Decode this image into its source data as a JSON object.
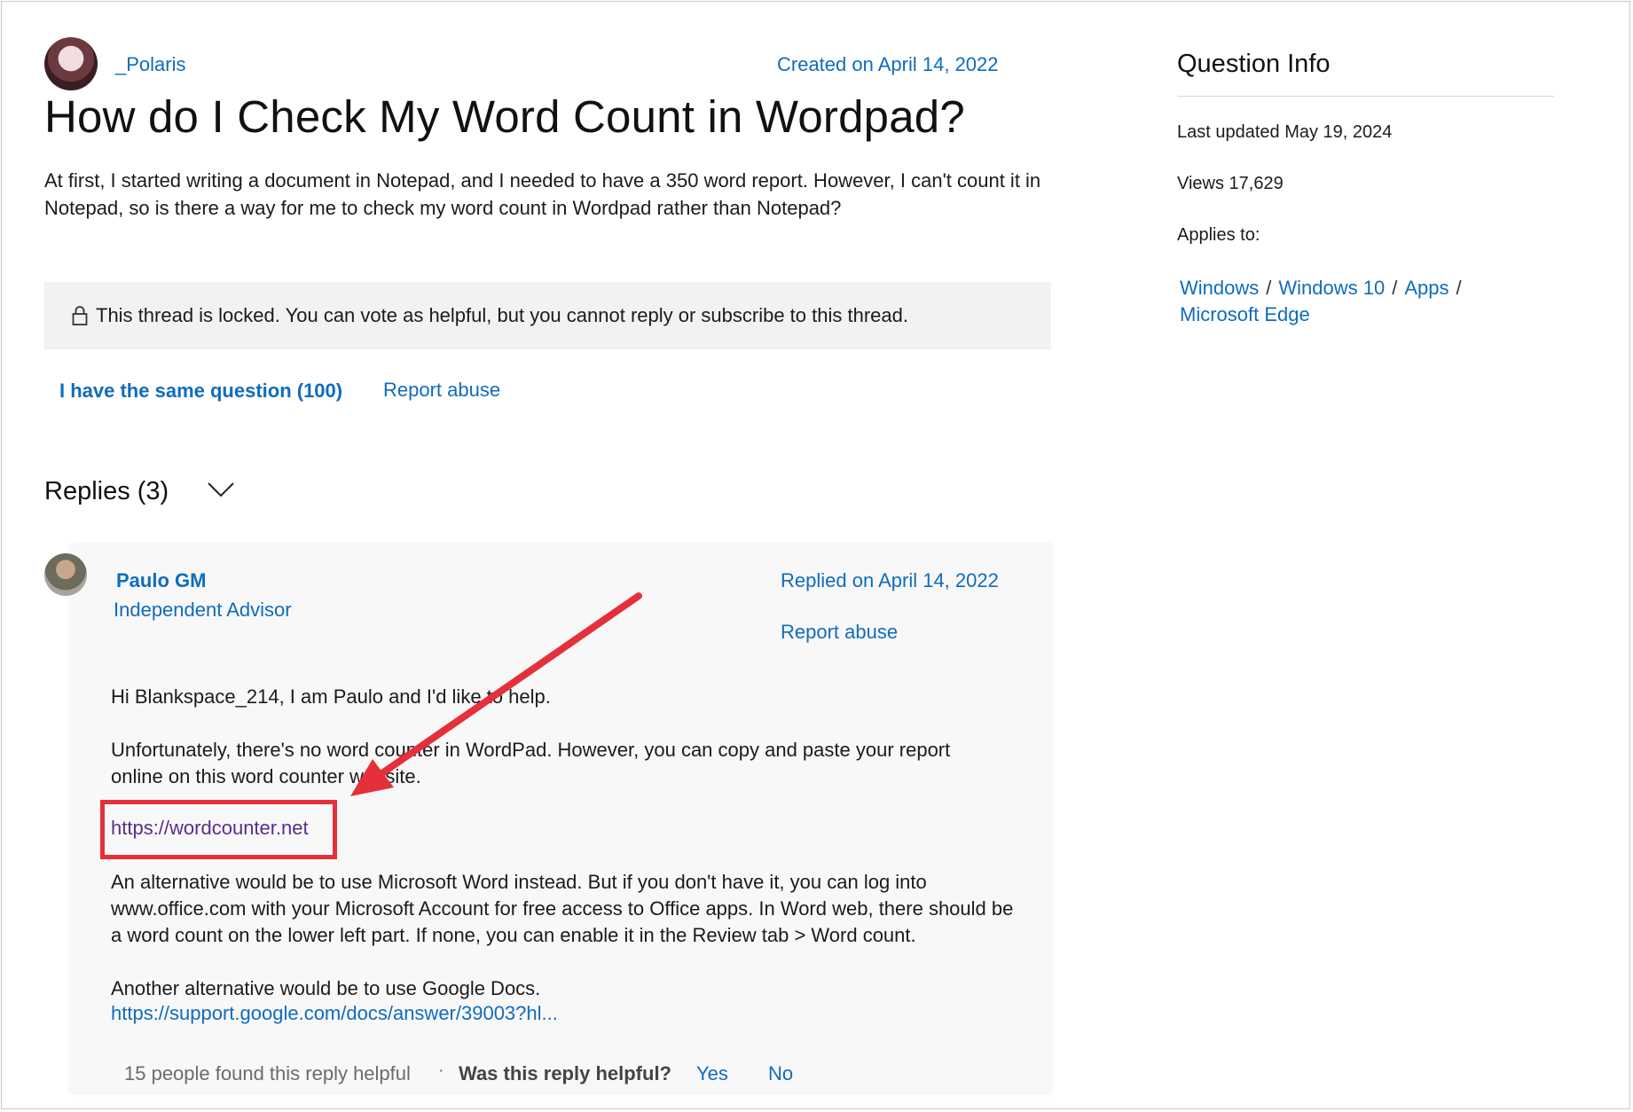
{
  "question": {
    "author": "_Polaris",
    "created": "Created on April 14, 2022",
    "title": "How do I Check My Word Count in Wordpad?",
    "body": "At first, I started writing a document in Notepad, and I needed to have a 350 word report. However, I can't count it in Notepad, so is there a way for me to check my word count in Wordpad rather than Notepad?",
    "locked_notice": "This thread is locked. You can vote as helpful, but you cannot reply or subscribe to this thread.",
    "same_question": "I have the same question (100)",
    "report_abuse": "Report abuse"
  },
  "replies": {
    "header": "Replies (3)",
    "reply": {
      "author": "Paulo GM",
      "role": "Independent Advisor",
      "replied": "Replied on April 14, 2022",
      "report_abuse": "Report abuse",
      "p1": "Hi Blankspace_214, I am Paulo and I'd like to help.",
      "p2": "Unfortunately, there's no word counter in WordPad. However, you can copy and paste your report online on this word counter website.",
      "link1": "https://wordcounter.net",
      "p3": "An alternative would be to use Microsoft Word instead. But if you don't have it, you can log into www.office.com with your Microsoft Account for free access to Office apps. In Word web, there should be a word count on the lower left part. If none, you can enable it in the Review tab > Word count.",
      "p4": "Another alternative would be to use Google Docs.",
      "link2": "https://support.google.com/docs/answer/39003?hl...",
      "helpful_count": "15 people found this reply helpful",
      "dot": "·",
      "was_helpful": "Was this reply helpful?",
      "yes": "Yes",
      "no": "No"
    }
  },
  "sidebar": {
    "title": "Question Info",
    "last_updated": "Last updated May 19, 2024",
    "views": "Views 17,629",
    "applies_to": "Applies to:",
    "crumbs": [
      "Windows",
      "Windows 10",
      "Apps",
      "Microsoft Edge"
    ],
    "separator": "/"
  },
  "colors": {
    "link": "#0f6cbd",
    "highlight": "#e5303a",
    "visited_link": "#5a2d8c",
    "locked_bg": "#f2f2f2"
  }
}
